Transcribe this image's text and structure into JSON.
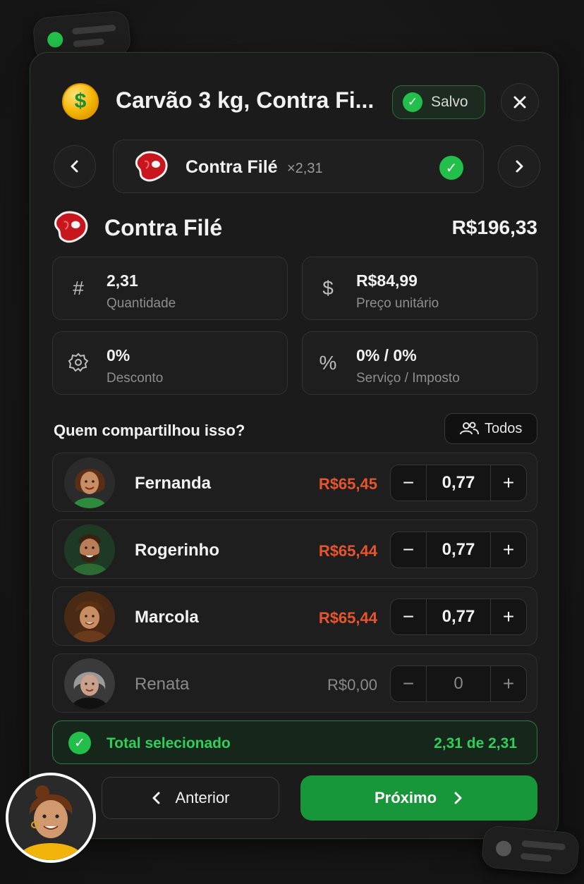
{
  "colors": {
    "accent_green": "#17973a",
    "success_green": "#2fcf5c",
    "amount_red": "#e8552c",
    "background": "#1b1b1b"
  },
  "header": {
    "title": "Carvão 3 kg, Contra Fi...",
    "saved_label": "Salvo",
    "close_icon": "close-icon"
  },
  "selector": {
    "name": "Contra Filé",
    "multiplier": "×2,31",
    "prev_icon": "chevron-left-icon",
    "next_icon": "chevron-right-icon"
  },
  "item": {
    "name": "Contra Filé",
    "price": "R$196,33",
    "fields": [
      {
        "icon": "hash-icon",
        "value": "2,31",
        "label": "Quantidade"
      },
      {
        "icon": "dollar-icon",
        "value": "R$84,99",
        "label": "Preço unitário"
      },
      {
        "icon": "discount-badge-icon",
        "value": "0%",
        "label": "Desconto"
      },
      {
        "icon": "percent-icon",
        "value": "0% / 0%",
        "label": "Serviço / Imposto"
      }
    ]
  },
  "share": {
    "question": "Quem compartilhou isso?",
    "all_label": "Todos",
    "people": [
      {
        "name": "Fernanda",
        "amount": "R$65,45",
        "qty": "0,77",
        "active": true
      },
      {
        "name": "Rogerinho",
        "amount": "R$65,44",
        "qty": "0,77",
        "active": true
      },
      {
        "name": "Marcola",
        "amount": "R$65,44",
        "qty": "0,77",
        "active": true
      },
      {
        "name": "Renata",
        "amount": "R$0,00",
        "qty": "0",
        "active": false
      }
    ]
  },
  "total": {
    "label": "Total selecionado",
    "value": "2,31 de 2,31"
  },
  "nav": {
    "prev_label": "Anterior",
    "next_label": "Próximo"
  }
}
